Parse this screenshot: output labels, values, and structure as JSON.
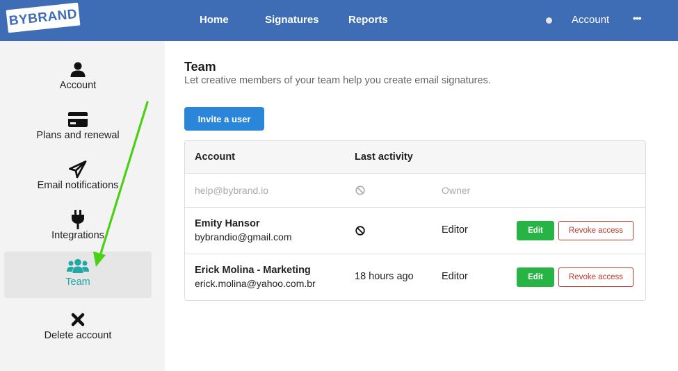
{
  "header": {
    "logo_text": "BYBRAND",
    "nav": [
      {
        "label": "Home"
      },
      {
        "label": "Signatures"
      },
      {
        "label": "Reports"
      }
    ],
    "account_label": "Account",
    "more_label": "•••"
  },
  "sidebar": {
    "items": [
      {
        "label": "Account",
        "icon": "user-icon"
      },
      {
        "label": "Plans and renewal",
        "icon": "credit-card-icon"
      },
      {
        "label": "Email notifications",
        "icon": "paper-plane-icon"
      },
      {
        "label": "Integrations",
        "icon": "plug-icon"
      },
      {
        "label": "Team",
        "icon": "users-icon",
        "active": true
      },
      {
        "label": "Delete account",
        "icon": "close-x-icon"
      }
    ]
  },
  "main": {
    "title": "Team",
    "subtitle": "Let creative members of your team help you create email signatures.",
    "invite_label": "Invite a user",
    "table": {
      "headers": [
        "Account",
        "Last activity"
      ],
      "rows": [
        {
          "name": "",
          "email": "help@bybrand.io",
          "activity": "",
          "role": "Owner"
        },
        {
          "name": "Emity Hansor",
          "email": "bybrandio@gmail.com",
          "activity": "",
          "role": "Editor",
          "edit": "Edit",
          "revoke": "Revoke access"
        },
        {
          "name": "Erick Molina - Marketing",
          "email": "erick.molina@yahoo.com.br",
          "activity": "18 hours ago",
          "role": "Editor",
          "edit": "Edit",
          "revoke": "Revoke access"
        }
      ]
    }
  },
  "colors": {
    "header_bg": "#3f6db5",
    "accent_teal": "#1fa8a4",
    "primary_button": "#2b86d9",
    "edit_button": "#27b444",
    "revoke_border": "#c0392b",
    "annotation_arrow": "#4ad116"
  }
}
